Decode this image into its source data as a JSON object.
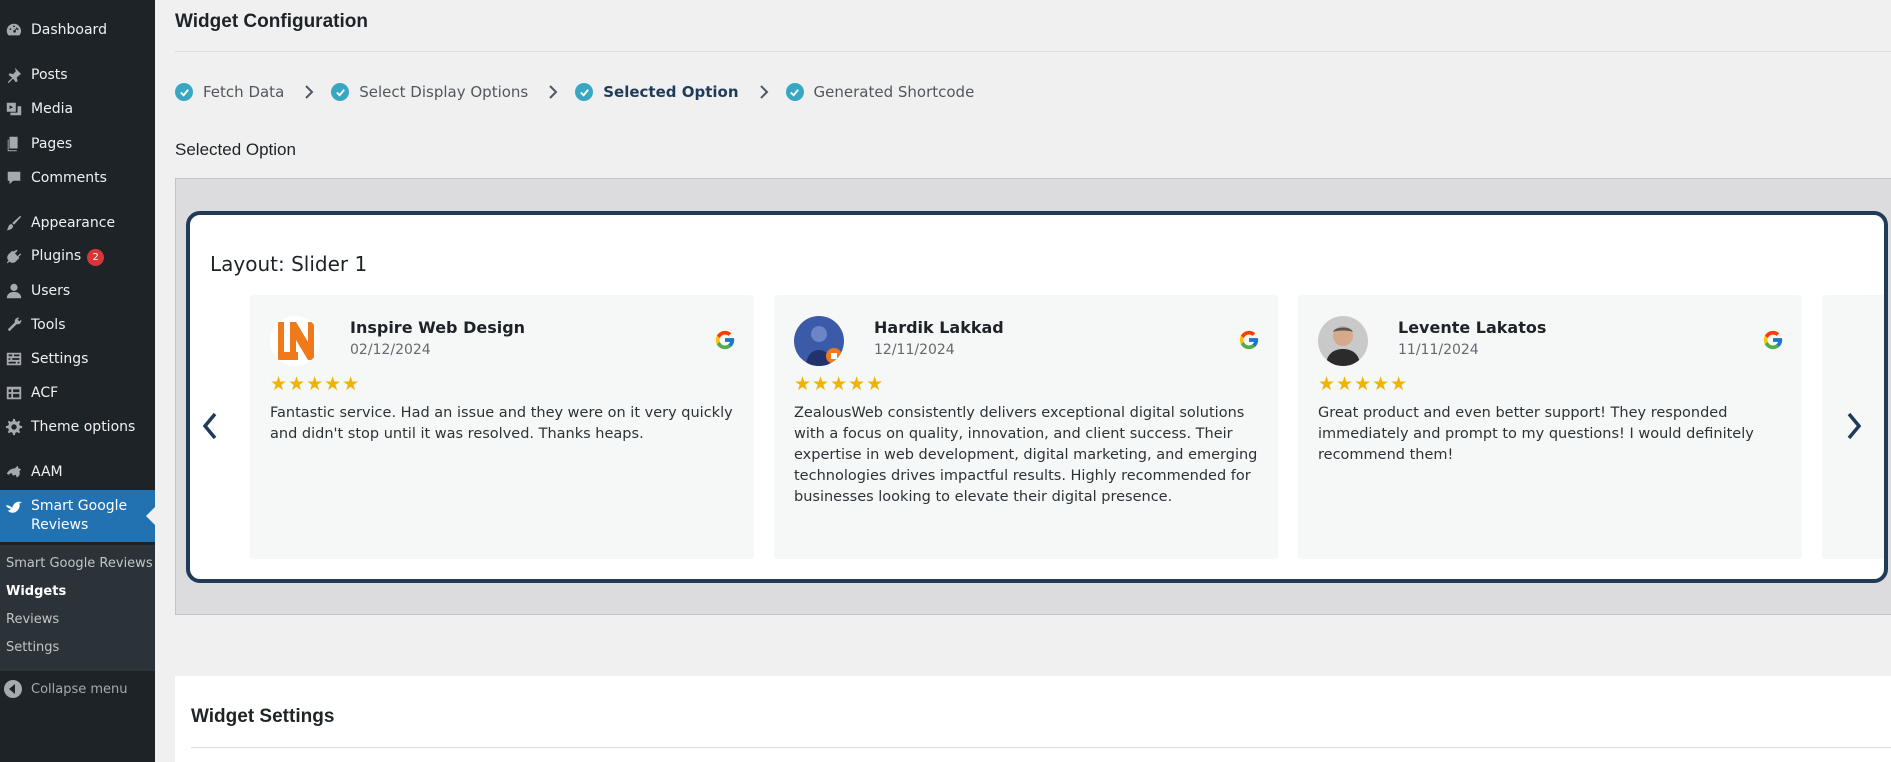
{
  "sidebar": {
    "items": [
      {
        "label": "Dashboard",
        "icon": "dashboard-icon"
      },
      {
        "label": "Posts",
        "icon": "pin-icon"
      },
      {
        "label": "Media",
        "icon": "media-icon"
      },
      {
        "label": "Pages",
        "icon": "pages-icon"
      },
      {
        "label": "Comments",
        "icon": "comment-icon"
      },
      {
        "label": "Appearance",
        "icon": "brush-icon"
      },
      {
        "label": "Plugins",
        "icon": "plugin-icon",
        "badge": "2"
      },
      {
        "label": "Users",
        "icon": "user-icon"
      },
      {
        "label": "Tools",
        "icon": "wrench-icon"
      },
      {
        "label": "Settings",
        "icon": "settings-icon"
      },
      {
        "label": "ACF",
        "icon": "table-icon"
      },
      {
        "label": "Theme options",
        "icon": "gear-icon"
      },
      {
        "label": "AAM",
        "icon": "aam-icon"
      },
      {
        "label": "Smart Google Reviews",
        "icon": "bird-icon",
        "active": true
      }
    ],
    "submenu": [
      "Smart Google Reviews",
      "Widgets",
      "Reviews",
      "Settings"
    ],
    "submenu_current": "Widgets",
    "collapse_label": "Collapse menu"
  },
  "main": {
    "page_title": "Widget Configuration",
    "steps": [
      {
        "label": "Fetch Data",
        "status": "done"
      },
      {
        "label": "Select Display Options",
        "status": "done"
      },
      {
        "label": "Selected Option",
        "status": "current"
      },
      {
        "label": "Generated Shortcode",
        "status": "done"
      }
    ],
    "section_title": "Selected Option",
    "layout_title": "Layout: Slider 1",
    "reviews": [
      {
        "name": "Inspire Web Design",
        "date": "02/12/2024",
        "rating": 5,
        "stars": "★★★★★",
        "text": "Fantastic service. Had an issue and they were on it very quickly and didn't stop until it was resolved. Thanks heaps.",
        "avatar": "inspire-logo"
      },
      {
        "name": "Hardik Lakkad",
        "date": "12/11/2024",
        "rating": 5,
        "stars": "★★★★★",
        "text": "ZealousWeb consistently delivers exceptional digital solutions with a focus on quality, innovation, and client success. Their expertise in web development, digital marketing, and emerging technologies drives impactful results. Highly recommended for businesses looking to elevate their digital presence.",
        "avatar": "user-photo"
      },
      {
        "name": "Levente Lakatos",
        "date": "11/11/2024",
        "rating": 5,
        "stars": "★★★★★",
        "text": "Great product and even better support! They responded immediately and prompt to my questions! I would definitely recommend them!",
        "avatar": "user-photo"
      }
    ],
    "settings_title": "Widget Settings"
  },
  "colors": {
    "sidebar_bg": "#1d2327",
    "active_menu": "#2271b1",
    "step_check": "#3aa7c2",
    "card_border": "#1f3b57",
    "star": "#f0b400",
    "badge": "#d63638"
  }
}
